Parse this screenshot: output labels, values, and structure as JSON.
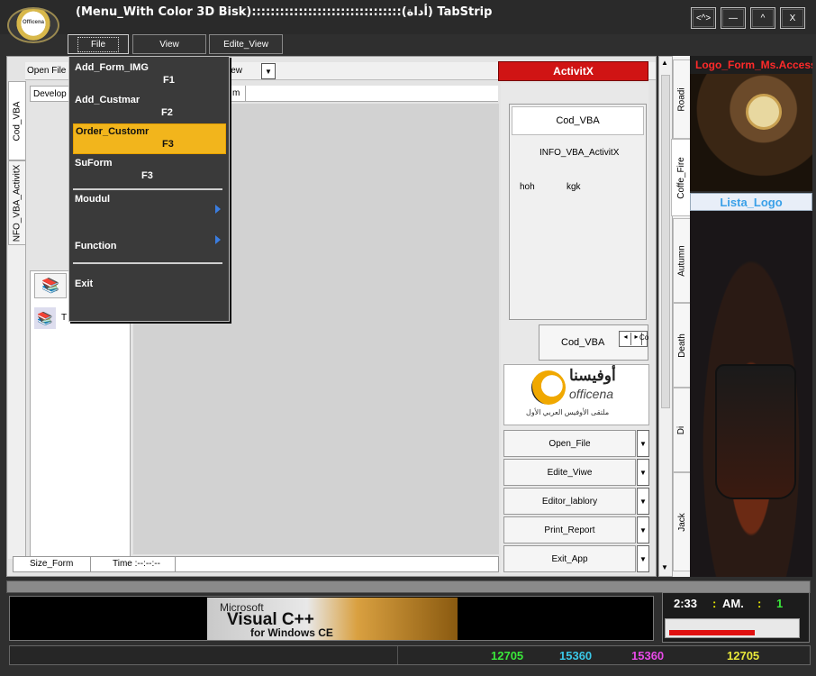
{
  "window": {
    "title": "(Menu_With Color 3D Bisk)::::::::::::::::::::::::::::::::(أداة) TabStrip",
    "logo_text": "Officena",
    "controls": {
      "restore": "<^>",
      "minimize": "—",
      "maximize": "^",
      "close": "X"
    }
  },
  "menubar": {
    "file": "File",
    "view": "View",
    "edit_view": "Edite_View"
  },
  "file_menu": {
    "items": [
      {
        "label": "Add_Form_IMG",
        "shortcut": "F1"
      },
      {
        "label": "Add_Custmar",
        "shortcut": "F2"
      },
      {
        "label": "Order_Customr",
        "shortcut": "F3"
      },
      {
        "label": "SuForm",
        "shortcut": "F3"
      },
      {
        "label": "Moudul",
        "shortcut": ""
      },
      {
        "label": "Function",
        "shortcut": ""
      },
      {
        "label": "Exit",
        "shortcut": ""
      }
    ]
  },
  "toolbar": {
    "open_file": "Open File",
    "view_partial": "iew",
    "develop": "Develop",
    "tab_partial": "m"
  },
  "left_tabs": {
    "cod_vba": "Cod_VBA",
    "info_vba": "NFO_VBA_ActivitX"
  },
  "left_panel": {
    "item_label": "T"
  },
  "status_strip": {
    "size_form": "Size_Form",
    "time": "Time :--:--:--"
  },
  "activitx": {
    "title": "ActivitX"
  },
  "info_panel": {
    "cod_vba": "Cod_VBA",
    "info": "INFO_VBA_ActivitX",
    "left_text": "hoh",
    "right_text": "kgk"
  },
  "cod_vba2": {
    "label": "Cod_VBA",
    "spin_text": "Coo"
  },
  "officena": {
    "arabic": "أوفيسنا",
    "latin": "officena",
    "sub": "ملتقى الأوفيس العربي الأول"
  },
  "side_buttons": [
    {
      "label": "Open_File"
    },
    {
      "label": "Edite_Viwe"
    },
    {
      "label": "Editor_lablory"
    },
    {
      "label": "Print_Report"
    },
    {
      "label": "Exit_App"
    }
  ],
  "right_tabs": [
    "Roadi",
    "Coffe_Fire",
    "Autumn",
    "Death",
    "Di",
    "Jack"
  ],
  "right_images": {
    "logo_title": "Logo_Form_Ms.Access",
    "lista_logo": "Lista_Logo"
  },
  "banner": {
    "microsoft": "Microsoft",
    "visual_c": "Visual C++",
    "for_windows": "for Windows CE"
  },
  "clock": {
    "time": "2:33",
    "colon1": ":",
    "am": "AM.",
    "colon2": ":",
    "seconds": "1",
    "progress": 0.68
  },
  "status_numbers": [
    {
      "value": "12705",
      "color": "#3ae83a"
    },
    {
      "value": "15360",
      "color": "#3ac8e8"
    },
    {
      "value": "15360",
      "color": "#e84ae8"
    },
    {
      "value": "12705",
      "color": "#e8e83a"
    }
  ]
}
